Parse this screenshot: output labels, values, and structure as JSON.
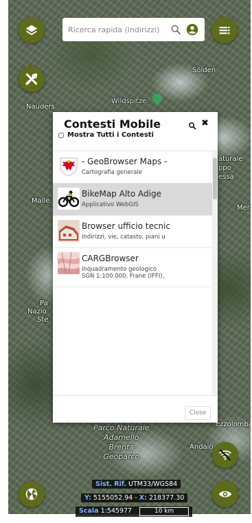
{
  "search": {
    "placeholder": "Ricerca rapida (indirizzi)"
  },
  "map_labels": {
    "solden": "Sölden",
    "nauders": "Nauders",
    "wildspitze": "Wildspitze",
    "malles": "Malle",
    "merano": "Mera",
    "naturale": "aturale",
    "gruppo": "ppo",
    "essa": "essa",
    "nazionale_1": "Pa",
    "nazionale_2": "Nazio",
    "nazionale_3": "Ste",
    "park": "Parco Naturale\nAdamello\nBrenta\nGeoparco",
    "andalo": "Andalo",
    "mezzolombardo": "ezzolomba"
  },
  "modal": {
    "title": "Contesti Mobile",
    "show_all_label": "Mostra Tutti i Contesti",
    "close_label": "Close",
    "items": [
      {
        "title": "- GeoBrowser Maps -",
        "subtitle": "Cartografia generale",
        "subtitle2": "",
        "icon": "tyrol-eagle-icon"
      },
      {
        "title": "BikeMap Alto Adige",
        "subtitle": "Applicativo WebGIS",
        "subtitle2": "",
        "icon": "bicycle-icon"
      },
      {
        "title": "Browser ufficio tecnic",
        "subtitle": "Indirizzi, vie, catasto, piani u",
        "subtitle2": "",
        "icon": "building-thumbnail-icon"
      },
      {
        "title": "CARGBrowser",
        "subtitle": "Inquadramento geologico",
        "subtitle2": "SGN 1:100.000, Frane (IFFI),",
        "icon": "geology-map-thumbnail-icon"
      }
    ]
  },
  "info": {
    "ref_label": "Sist. Rif.",
    "ref_value": "UTM33/WGS84",
    "y_label": "Y:",
    "y_value": "5155052.94",
    "x_label": "X:",
    "x_value": "218377.30",
    "scale_label": "Scala",
    "scale_value": "1:545977",
    "scalebar_label": "10 km"
  },
  "colors": {
    "fab": "#5d6b1c",
    "accent_blue": "#7fb0ff"
  }
}
